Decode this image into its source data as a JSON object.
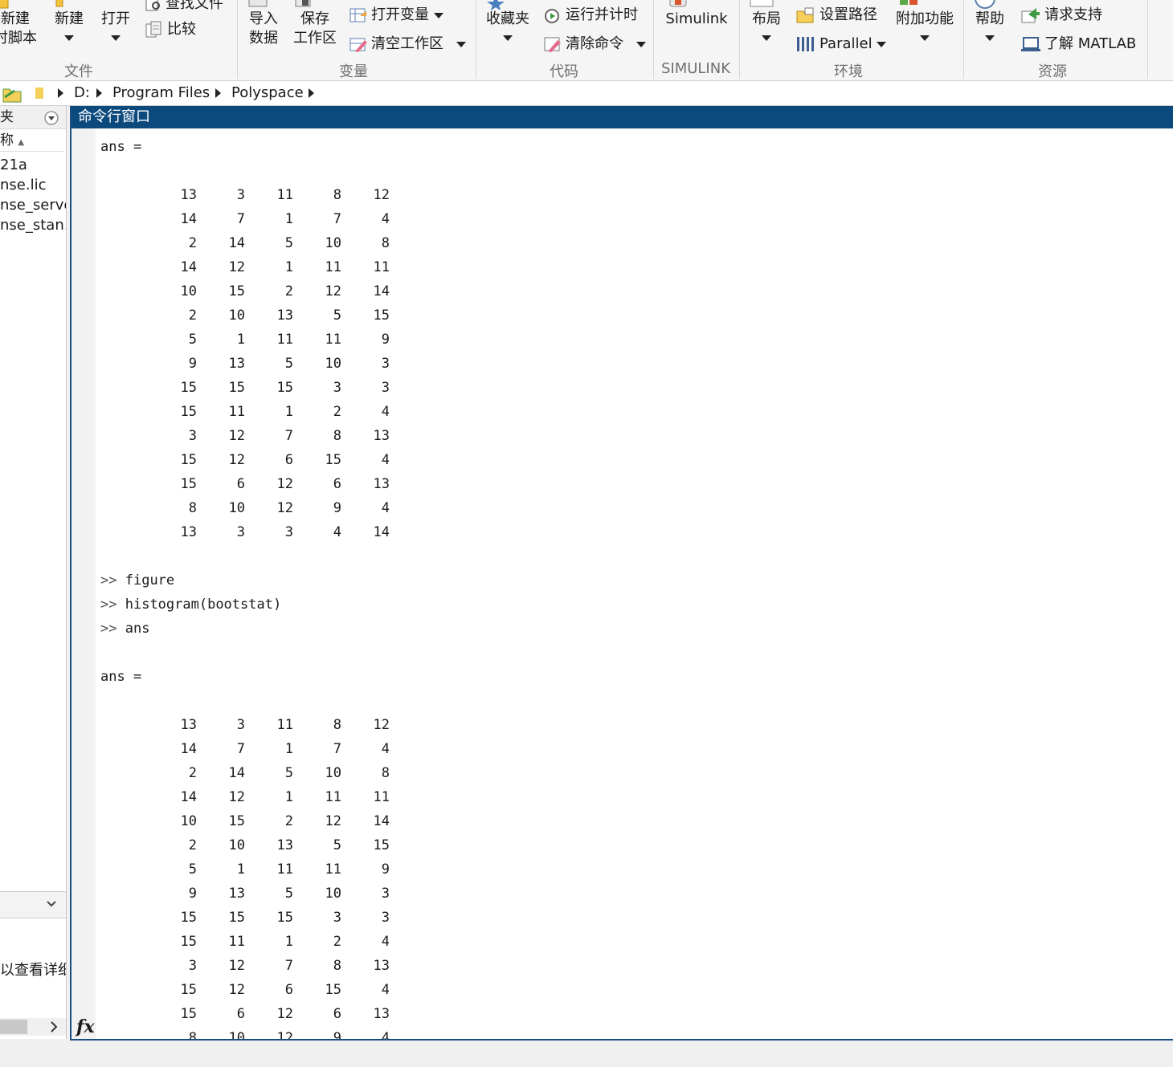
{
  "ribbon": {
    "file_group": {
      "new_live_script": [
        "新建",
        "时脚本"
      ],
      "new": "新建",
      "open": "打开",
      "find_files": "查找文件",
      "compare": "比较",
      "label": "文件"
    },
    "variable_group": {
      "import_data": [
        "导入",
        "数据"
      ],
      "save_workspace": [
        "保存",
        "工作区"
      ],
      "open_variable": "打开变量",
      "clear_workspace": "清空工作区",
      "label": "变量"
    },
    "code_group": {
      "favorites": "收藏夹",
      "run_and_time": "运行并计时",
      "clear_commands": "清除命令",
      "label": "代码"
    },
    "simulink_group": {
      "simulink": "Simulink",
      "label": "SIMULINK"
    },
    "environment_group": {
      "layout": "布局",
      "set_path": "设置路径",
      "parallel": "Parallel",
      "addons": "附加功能",
      "label": "环境"
    },
    "resources_group": {
      "help": "帮助",
      "request_support": "请求支持",
      "learn_matlab": "了解 MATLAB",
      "label": "资源"
    }
  },
  "address": {
    "crumbs": [
      "D:",
      "Program Files",
      "Polyspace"
    ]
  },
  "left_panel": {
    "header": "夹",
    "column_header": "称",
    "files": [
      "21a",
      "nse.lic",
      "nse_serve…",
      "nse_stan…"
    ],
    "details_message": "以查看详细信"
  },
  "command_window": {
    "title": "命令行窗口",
    "ans_label": "ans =",
    "matrix": [
      [
        13,
        3,
        11,
        8,
        12
      ],
      [
        14,
        7,
        1,
        7,
        4
      ],
      [
        2,
        14,
        5,
        10,
        8
      ],
      [
        14,
        12,
        1,
        11,
        11
      ],
      [
        10,
        15,
        2,
        12,
        14
      ],
      [
        2,
        10,
        13,
        5,
        15
      ],
      [
        5,
        1,
        11,
        11,
        9
      ],
      [
        9,
        13,
        5,
        10,
        3
      ],
      [
        15,
        15,
        15,
        3,
        3
      ],
      [
        15,
        11,
        1,
        2,
        4
      ],
      [
        3,
        12,
        7,
        8,
        13
      ],
      [
        15,
        12,
        6,
        15,
        4
      ],
      [
        15,
        6,
        12,
        6,
        13
      ],
      [
        8,
        10,
        12,
        9,
        4
      ],
      [
        13,
        3,
        3,
        4,
        14
      ]
    ],
    "prompt": ">>",
    "commands": [
      "figure",
      "histogram(bootstat)",
      "ans"
    ],
    "fx_label": "fx"
  },
  "colors": {
    "title_bar": "#0c4a7e",
    "border_blue": "#154f86"
  }
}
